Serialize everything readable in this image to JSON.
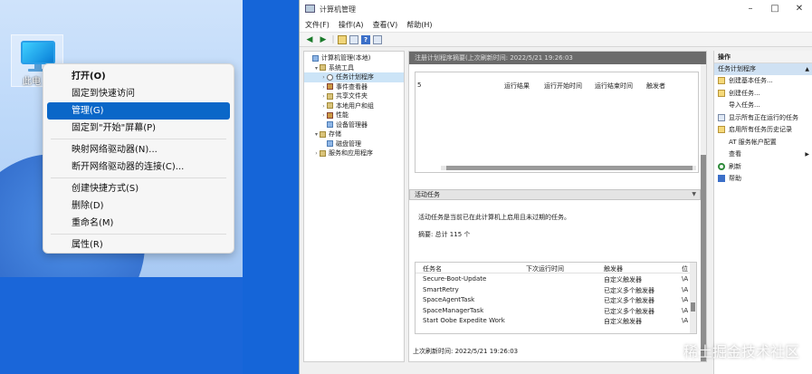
{
  "desktop": {
    "icon_label": "此电",
    "context_menu": {
      "groups": [
        [
          {
            "label": "打开(O)",
            "bold": true
          },
          {
            "label": "固定到快速访问"
          },
          {
            "label": "管理(G)",
            "selected": true
          },
          {
            "label": "固定到\"开始\"屏幕(P)"
          }
        ],
        [
          {
            "label": "映射网络驱动器(N)..."
          },
          {
            "label": "断开网络驱动器的连接(C)..."
          }
        ],
        [
          {
            "label": "创建快捷方式(S)"
          },
          {
            "label": "删除(D)"
          },
          {
            "label": "重命名(M)"
          }
        ],
        [
          {
            "label": "属性(R)"
          }
        ]
      ]
    }
  },
  "window": {
    "title": "计算机管理",
    "menu": [
      "文件(F)",
      "操作(A)",
      "查看(V)",
      "帮助(H)"
    ],
    "controls": {
      "minimize": "–",
      "maximize": "□",
      "close": "✕"
    },
    "tree": [
      {
        "label": "计算机管理(本地)",
        "level": 0,
        "twisty": "",
        "icon": "pc"
      },
      {
        "label": "系统工具",
        "level": 1,
        "twisty": "▾",
        "icon": "folder"
      },
      {
        "label": "任务计划程序",
        "level": 2,
        "twisty": "›",
        "icon": "clock",
        "selected": true
      },
      {
        "label": "事件查看器",
        "level": 2,
        "twisty": "›",
        "icon": "log"
      },
      {
        "label": "共享文件夹",
        "level": 2,
        "twisty": "›",
        "icon": "folder"
      },
      {
        "label": "本地用户和组",
        "level": 2,
        "twisty": "›",
        "icon": "folder"
      },
      {
        "label": "性能",
        "level": 2,
        "twisty": "›",
        "icon": "log"
      },
      {
        "label": "设备管理器",
        "level": 2,
        "twisty": "",
        "icon": "pc"
      },
      {
        "label": "存储",
        "level": 1,
        "twisty": "▾",
        "icon": "folder"
      },
      {
        "label": "磁盘管理",
        "level": 2,
        "twisty": "",
        "icon": "pc"
      },
      {
        "label": "服务和应用程序",
        "level": 1,
        "twisty": "›",
        "icon": "folder"
      }
    ],
    "center": {
      "header": "注册计划程序摘要(上次刷新时间: 2022/5/21 19:26:03",
      "status_columns": [
        "5",
        "运行结果",
        "运行开始时间",
        "运行结束时间",
        "触发者"
      ],
      "active_section": "活动任务",
      "active_desc": "活动任务是当前已在此计算机上启用且未过期的任务。",
      "active_summary": "摘要: 总计 115 个",
      "task_columns": [
        "任务名",
        "下次运行时间",
        "触发器",
        "位"
      ],
      "tasks": [
        {
          "name": "Secure-Boot-Update",
          "next": "",
          "trigger": "自定义触发器",
          "loc": "\\A"
        },
        {
          "name": "SmartRetry",
          "next": "",
          "trigger": "已定义多个触发器",
          "loc": "\\A"
        },
        {
          "name": "SpaceAgentTask",
          "next": "",
          "trigger": "已定义多个触发器",
          "loc": "\\A"
        },
        {
          "name": "SpaceManagerTask",
          "next": "",
          "trigger": "已定义多个触发器",
          "loc": "\\A"
        },
        {
          "name": "Start Oobe Expedite Work",
          "next": "",
          "trigger": "自定义触发器",
          "loc": "\\A"
        }
      ],
      "last_refresh": "上次刷新时间: 2022/5/21 19:26:03"
    },
    "actions": {
      "title": "操作",
      "subtitle": "任务计划程序",
      "items": [
        {
          "label": "创建基本任务...",
          "icon": "doc"
        },
        {
          "label": "创建任务...",
          "icon": "doc"
        },
        {
          "label": "导入任务...",
          "icon": "none"
        },
        {
          "label": "显示所有正在运行的任务",
          "icon": "grid"
        },
        {
          "label": "启用所有任务历史记录",
          "icon": "doc"
        },
        {
          "label": "AT 服务帐户配置",
          "icon": "none"
        },
        {
          "label": "查看",
          "icon": "none",
          "submenu": true
        },
        {
          "label": "刷新",
          "icon": "refresh"
        },
        {
          "label": "帮助",
          "icon": "help"
        }
      ]
    }
  },
  "watermark": "稀土掘金技术社区"
}
